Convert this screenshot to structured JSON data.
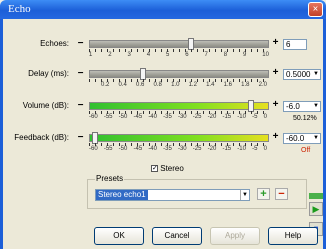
{
  "window": {
    "title": "Echo",
    "close_label": "×"
  },
  "sliders": [
    {
      "label": "Echoes:",
      "value": "6",
      "level": 0.55,
      "ticks": [
        "1",
        "2",
        "3",
        "4",
        "5",
        "6",
        "7",
        "8",
        "9",
        "10"
      ],
      "has_dropdown": false
    },
    {
      "label": "Delay (ms):",
      "value": "0.5000",
      "level": 0.3,
      "ticks": [
        "0.2",
        "0.4",
        "0.6",
        "0.8",
        "1.0",
        "1.2",
        "1.4",
        "1.6",
        "1.8",
        "2.0"
      ],
      "has_dropdown": true
    },
    {
      "label": "Volume (dB):",
      "value": "-6.0",
      "sub_value": "50.12%",
      "level": 0.9,
      "ticks": [
        "-60",
        "-55",
        "-50",
        "-45",
        "-40",
        "-35",
        "-30",
        "-25",
        "-20",
        "-15",
        "-10",
        "-5",
        "0"
      ],
      "has_dropdown": true
    },
    {
      "label": "Feedback (dB):",
      "value": "-60.0",
      "sub_value": "Off",
      "sub_color": "#cc2200",
      "level": 0.02,
      "ticks": [
        "-60",
        "-55",
        "-50",
        "-45",
        "-40",
        "-35",
        "-30",
        "-25",
        "-20",
        "-15",
        "-10",
        "-5",
        "0"
      ],
      "has_dropdown": true
    }
  ],
  "stereo": {
    "label": "Stereo",
    "checked": true
  },
  "presets": {
    "label": "Presets",
    "selected": "Stereo echo1",
    "add_label": "+",
    "remove_label": "−"
  },
  "buttons": {
    "ok": "OK",
    "cancel": "Cancel",
    "apply": "Apply",
    "help": "Help"
  },
  "colors": {
    "title_bar": "#1c5fd8",
    "green_track": "#30c030",
    "off_text": "#cc2200"
  }
}
